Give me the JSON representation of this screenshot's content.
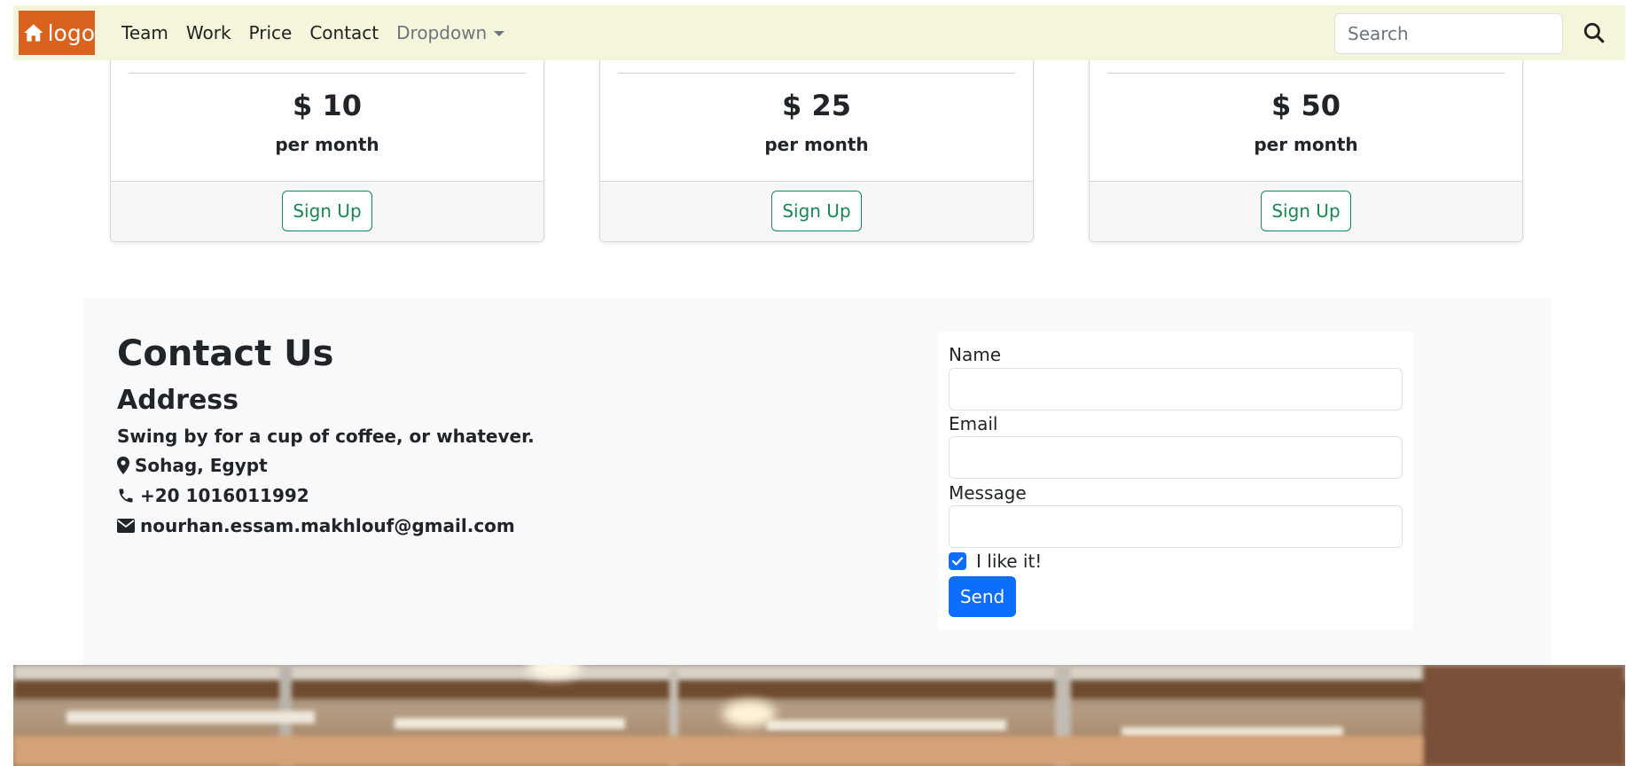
{
  "navbar": {
    "logo_text": "logo",
    "links": [
      "Team",
      "Work",
      "Price",
      "Contact"
    ],
    "dropdown_label": "Dropdown",
    "search_placeholder": "Search"
  },
  "pricing": {
    "cards": [
      {
        "price": "$ 10",
        "period": "per month",
        "button": "Sign Up"
      },
      {
        "price": "$ 25",
        "period": "per month",
        "button": "Sign Up"
      },
      {
        "price": "$ 50",
        "period": "per month",
        "button": "Sign Up"
      }
    ]
  },
  "contact": {
    "title": "Contact Us",
    "address_title": "Address",
    "description": "Swing by for a cup of coffee, or whatever.",
    "location": "Sohag, Egypt",
    "phone": "+20 1016011992",
    "email": "nourhan.essam.makhlouf@gmail.com"
  },
  "form": {
    "name_label": "Name",
    "email_label": "Email",
    "message_label": "Message",
    "checkbox_label": "I like it!",
    "checkbox_checked": true,
    "send_label": "Send"
  },
  "colors": {
    "navbar_bg": "#f5f5dc",
    "logo_bg": "#d9631e",
    "signup_green": "#198754",
    "primary_blue": "#0d6efd"
  }
}
